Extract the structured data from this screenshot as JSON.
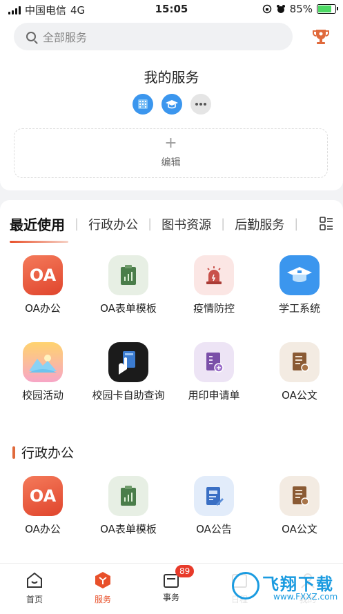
{
  "status_bar": {
    "carrier": "中国电信",
    "network": "4G",
    "time": "15:05",
    "battery": "85%"
  },
  "search": {
    "placeholder": "全部服务"
  },
  "my_services": {
    "title": "我的服务",
    "edit_label": "编辑",
    "plus": "+"
  },
  "tabs": {
    "items": [
      "最近使用",
      "行政办公",
      "图书资源",
      "后勤服务"
    ],
    "separator": "|"
  },
  "recent_apps": [
    {
      "name": "OA办公",
      "icon": "oa-icon",
      "badge_text": "OA"
    },
    {
      "name": "OA表单模板",
      "icon": "form-template-icon"
    },
    {
      "name": "疫情防控",
      "icon": "alarm-icon"
    },
    {
      "name": "学工系统",
      "icon": "graduation-cap-icon"
    },
    {
      "name": "校园活动",
      "icon": "landscape-icon"
    },
    {
      "name": "校园卡自助查询",
      "icon": "card-icon"
    },
    {
      "name": "用印申请单",
      "icon": "seal-application-icon"
    },
    {
      "name": "OA公文",
      "icon": "document-icon"
    }
  ],
  "admin_section": {
    "title": "行政办公",
    "apps": [
      {
        "name": "OA办公",
        "icon": "oa-icon",
        "badge_text": "OA"
      },
      {
        "name": "OA表单模板",
        "icon": "form-template-icon"
      },
      {
        "name": "OA公告",
        "icon": "announcement-icon"
      },
      {
        "name": "OA公文",
        "icon": "document-icon"
      }
    ]
  },
  "bottom_nav": {
    "items": [
      {
        "label": "首页",
        "icon": "home-icon"
      },
      {
        "label": "服务",
        "icon": "service-icon",
        "active": true
      },
      {
        "label": "事务",
        "icon": "tasks-icon",
        "badge": "89"
      },
      {
        "label": "日程",
        "icon": "calendar-icon"
      },
      {
        "label": "我的",
        "icon": "profile-icon"
      }
    ]
  },
  "watermark": {
    "text": "飞翔下载",
    "url": "www.FXXZ.com"
  },
  "colors": {
    "accent": "#e8502a",
    "badge": "#e83a2a",
    "blue": "#3b96ee"
  }
}
